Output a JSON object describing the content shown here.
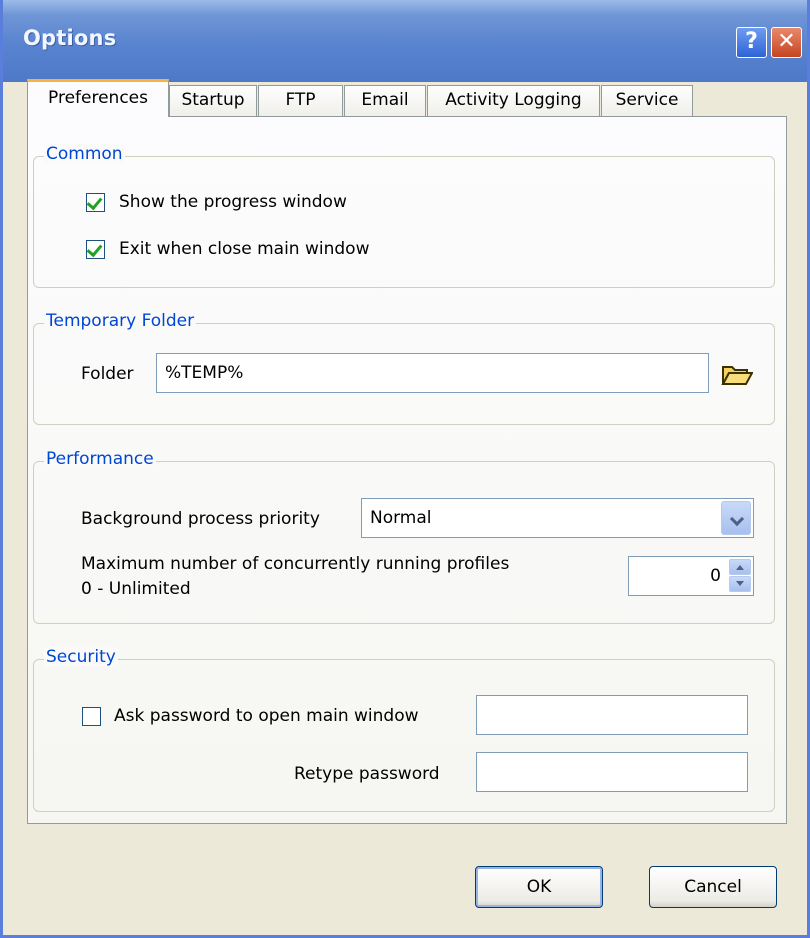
{
  "window": {
    "title": "Options",
    "help_glyph": "?",
    "close_glyph": "✕"
  },
  "tabs": [
    {
      "label": "Preferences",
      "active": true
    },
    {
      "label": "Startup",
      "active": false
    },
    {
      "label": "FTP",
      "active": false
    },
    {
      "label": "Email",
      "active": false
    },
    {
      "label": "Activity Logging",
      "active": false
    },
    {
      "label": "Service",
      "active": false
    }
  ],
  "common": {
    "legend": "Common",
    "show_progress": {
      "label": "Show the progress window",
      "checked": true
    },
    "exit_on_close": {
      "label": "Exit when close main window",
      "checked": true
    }
  },
  "temp_folder": {
    "legend": "Temporary Folder",
    "folder_label": "Folder",
    "folder_value": "%TEMP%",
    "browse_icon": "folder-open-icon"
  },
  "performance": {
    "legend": "Performance",
    "priority_label": "Background process priority",
    "priority_value": "Normal",
    "max_profiles_label": "Maximum number of concurrently running profiles",
    "max_profiles_hint": "0 - Unlimited",
    "max_profiles_value": "0"
  },
  "security": {
    "legend": "Security",
    "ask_password": {
      "label": "Ask password to open main window",
      "checked": false
    },
    "password_value": "",
    "retype_label": "Retype password",
    "retype_value": ""
  },
  "buttons": {
    "ok": "OK",
    "cancel": "Cancel"
  },
  "colors": {
    "accent": "#0046d5",
    "titlebar": "#5883cf",
    "check": "#21a121"
  }
}
